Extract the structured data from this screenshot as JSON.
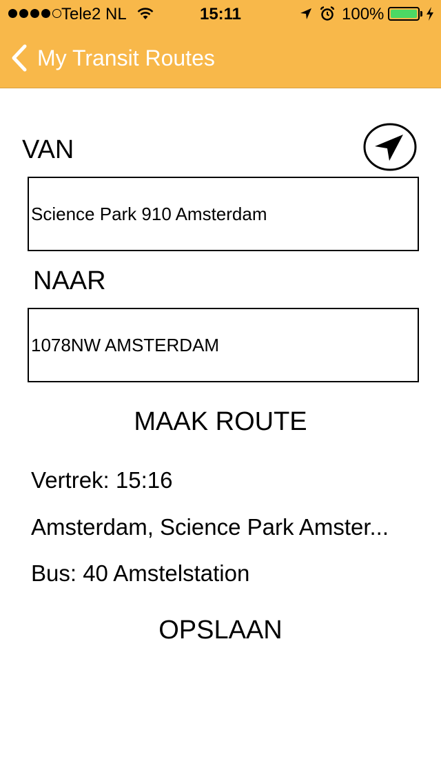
{
  "status_bar": {
    "carrier": "Tele2 NL",
    "time": "15:11",
    "battery_percent": "100%",
    "signal_bars_filled": 4,
    "signal_bars_total": 5,
    "icons": [
      "wifi-icon",
      "location-arrow-icon",
      "alarm-icon",
      "battery-icon",
      "charging-icon"
    ]
  },
  "nav": {
    "back_label": "My Transit Routes"
  },
  "form": {
    "from_label": "VAN",
    "from_value": "Science Park 910 Amsterdam",
    "to_label": "NAAR",
    "to_value": "1078NW AMSTERDAM",
    "make_route_label": "MAAK ROUTE"
  },
  "result": {
    "departure": "Vertrek: 15:16",
    "stop": "Amsterdam, Science Park Amster...",
    "bus": "Bus: 40 Amstelstation"
  },
  "save_label": "OPSLAAN",
  "colors": {
    "header_bg": "#F8B84A",
    "battery_fill": "#4CD964"
  }
}
